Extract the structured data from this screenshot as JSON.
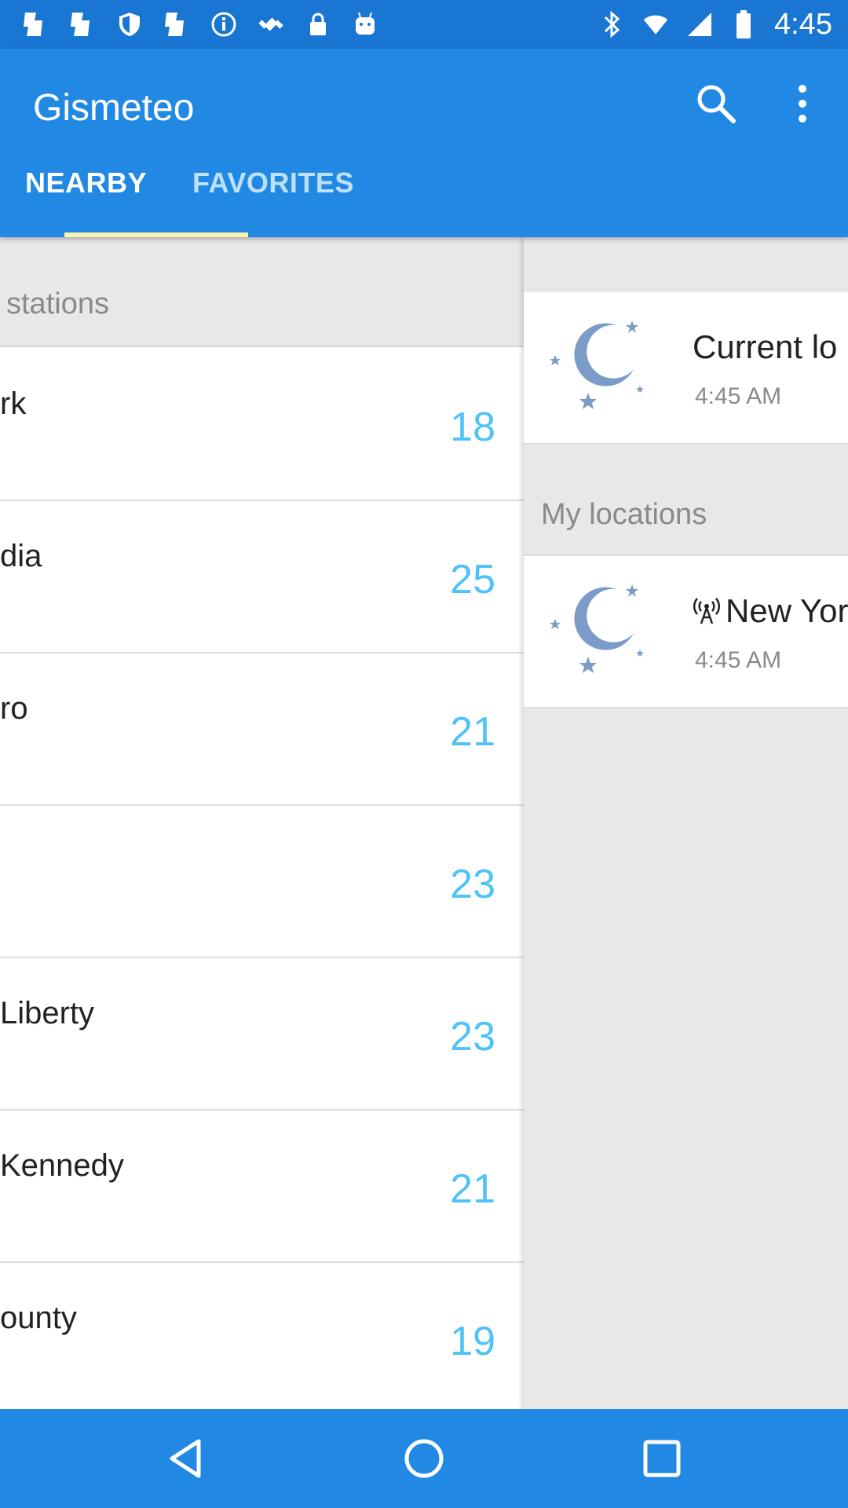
{
  "status_bar": {
    "time": "4:45",
    "left_icons": [
      "notification-icon",
      "notification-icon",
      "shield-icon",
      "notification-icon",
      "info-icon",
      "fake-gps-icon",
      "lock-icon",
      "android-icon"
    ],
    "right_icons": [
      "bluetooth-icon",
      "wifi-icon",
      "signal-icon",
      "battery-icon"
    ]
  },
  "app_bar": {
    "title": "Gismeteo",
    "tabs": [
      {
        "label": "NEARBY",
        "active": true
      },
      {
        "label": "FAVORITES",
        "active": false
      }
    ]
  },
  "nearby": {
    "header": "stations",
    "stations": [
      {
        "name": "rk",
        "temp": "18"
      },
      {
        "name": "dia",
        "temp": "25"
      },
      {
        "name": "ro",
        "temp": "21"
      },
      {
        "name": "",
        "temp": "23"
      },
      {
        "name": " Liberty",
        "temp": "23"
      },
      {
        "name": "Kennedy",
        "temp": "21"
      },
      {
        "name": "ounty",
        "temp": "19"
      }
    ]
  },
  "drawer": {
    "current": {
      "name": "Current lo",
      "time": "4:45 AM",
      "icon": "night-moon-icon"
    },
    "section_label": "My locations",
    "locations": [
      {
        "name": "New Yor",
        "time": "4:45 AM",
        "icon": "night-moon-icon",
        "prefix_icon": "radio-tower-icon"
      }
    ]
  },
  "colors": {
    "primary": "#2189e3",
    "status_bar": "#1976d2",
    "temp": "#4fc3f7",
    "tab_indicator": "#f6f3b3",
    "moon": "#7b9cc8"
  },
  "nav_bar": {
    "buttons": [
      "back-icon",
      "home-icon",
      "recents-icon"
    ]
  }
}
